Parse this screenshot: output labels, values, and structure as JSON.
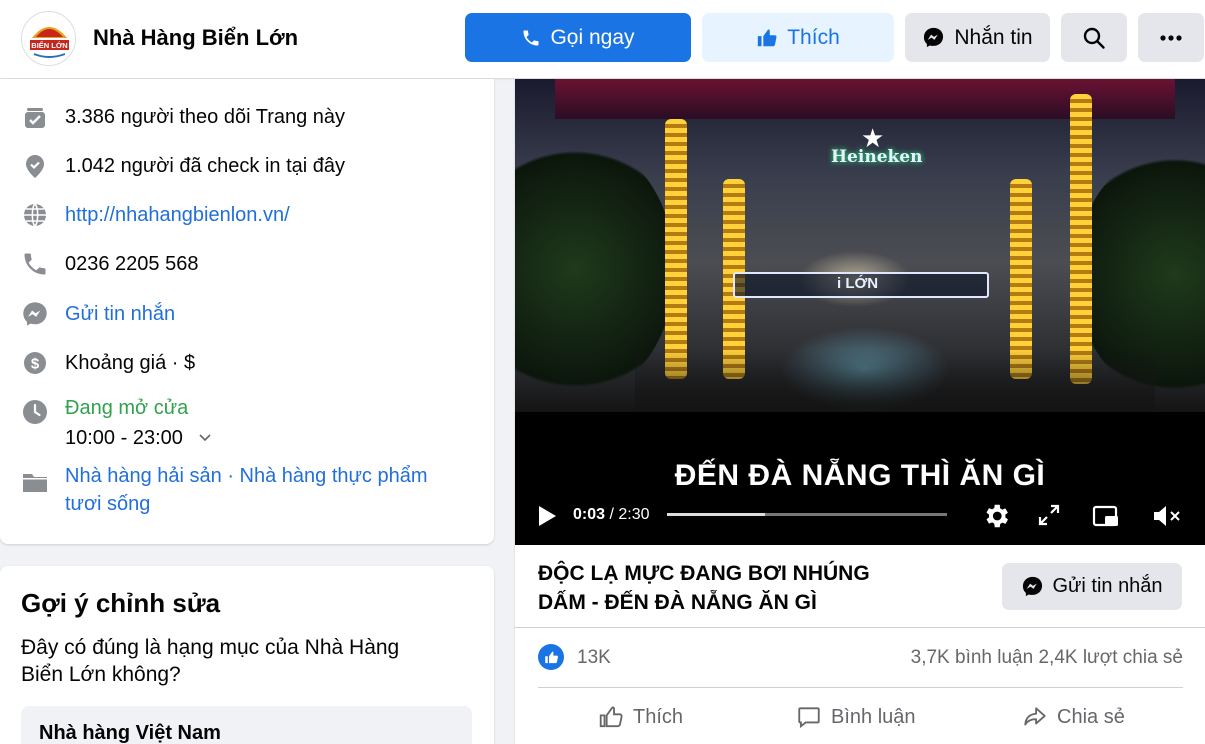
{
  "header": {
    "page_name": "Nhà Hàng Biển Lớn",
    "logo_text": "BIỂN LỚN",
    "call_label": "Gọi ngay",
    "like_label": "Thích",
    "message_label": "Nhắn tin"
  },
  "about": {
    "followers": "3.386 người theo dõi Trang này",
    "checkins": "1.042 người đã check in tại đây",
    "website": "http://nhahangbienlon.vn/",
    "phone": "0236 2205 568",
    "send_message": "Gửi tin nhắn",
    "price_range": "Khoảng giá · $",
    "open_status": "Đang mở cửa",
    "hours": "10:00 - 23:00",
    "category_line1": "Nhà hàng hải sản · Nhà hàng thực phẩm",
    "category_line2": "tươi sống"
  },
  "suggest": {
    "title": "Gợi ý chỉnh sửa",
    "question_line1": "Đây có đúng là hạng mục của Nhà Hàng",
    "question_line2": "Biển Lớn không?",
    "category": "Nhà hàng Việt Nam"
  },
  "video": {
    "sign_text": "Heineken",
    "led_text": "i LỚN",
    "caption": "ĐẾN ĐÀ NẴNG THÌ ĂN GÌ",
    "current_time": "0:03",
    "duration": "/ 2:30",
    "progress_fraction": 0.35
  },
  "post": {
    "title_line1": "ĐỘC LẠ MỰC ĐANG BƠI NHÚNG",
    "title_line2": "DẤM - ĐẾN ĐÀ NẴNG ĂN GÌ",
    "send_message_label": "Gửi tin nhắn",
    "likes": "13K",
    "comments": "3,7K bình luận",
    "shares": "2,4K lượt chia sẻ",
    "action_like": "Thích",
    "action_comment": "Bình luận",
    "action_share": "Chia sẻ"
  },
  "colors": {
    "accent": "#1b74e4",
    "link": "#216fdb",
    "open_green": "#31a24c"
  }
}
